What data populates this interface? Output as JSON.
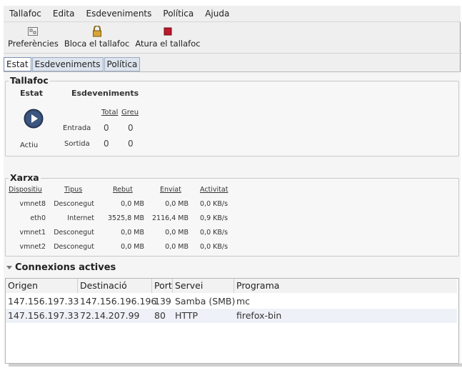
{
  "menu": [
    "Tallafoc",
    "Edita",
    "Esdeveniments",
    "Política",
    "Ajuda"
  ],
  "toolbar": {
    "preferences": "Preferències",
    "lock": "Bloca el tallafoc",
    "stop": "Atura el tallafoc"
  },
  "tabs": [
    "Estat",
    "Esdeveniments",
    "Política"
  ],
  "tallafoc": {
    "title": "Tallafoc",
    "estat_label": "Estat",
    "esdeveniments_label": "Esdeveniments",
    "total": "Total",
    "greu": "Greu",
    "entrada": "Entrada",
    "sortida": "Sortida",
    "entrada_total": "0",
    "entrada_greu": "0",
    "sortida_total": "0",
    "sortida_greu": "0",
    "status": "Actiu"
  },
  "xarxa": {
    "title": "Xarxa",
    "headers": [
      "Dispositiu",
      "Tipus",
      "Rebut",
      "Enviat",
      "Activitat"
    ],
    "rows": [
      [
        "vmnet8",
        "Desconegut",
        "0,0 MB",
        "0,0 MB",
        "0,0 KB/s"
      ],
      [
        "eth0",
        "Internet",
        "3525,8 MB",
        "2116,4 MB",
        "0,9 KB/s"
      ],
      [
        "vmnet1",
        "Desconegut",
        "0,0 MB",
        "0,0 MB",
        "0,0 KB/s"
      ],
      [
        "vmnet2",
        "Desconegut",
        "0,0 MB",
        "0,0 MB",
        "0,0 KB/s"
      ]
    ]
  },
  "connexions": {
    "title": "Connexions actives",
    "headers": [
      "Origen",
      "Destinació",
      "Port",
      "Servei",
      "Programa"
    ],
    "rows": [
      [
        "147.156.197.33",
        "147.156.196.196",
        "139",
        "Samba (SMB)",
        "mc"
      ],
      [
        "147.156.197.33",
        "72.14.207.99",
        "80",
        "HTTP",
        "firefox-bin"
      ]
    ]
  }
}
